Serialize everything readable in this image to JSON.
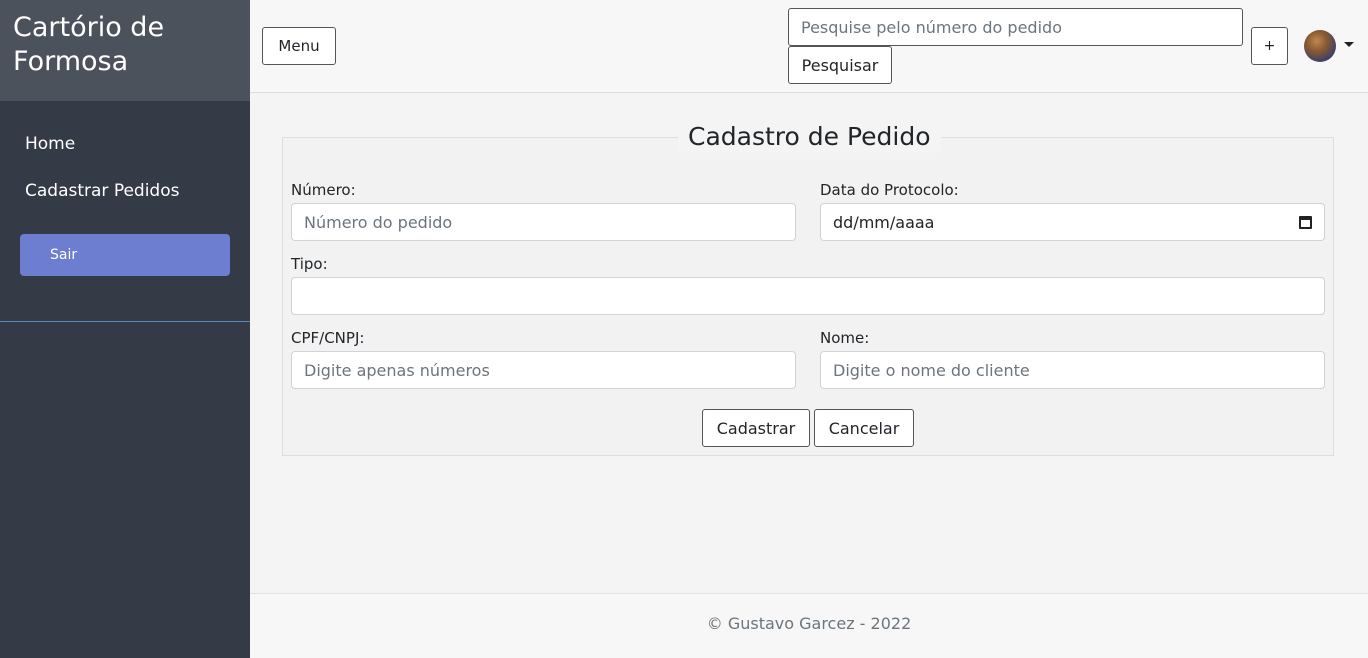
{
  "sidebar": {
    "brand": "Cartório de Formosa",
    "items": [
      {
        "label": "Home"
      },
      {
        "label": "Cadastrar Pedidos"
      }
    ],
    "logout_label": "Sair"
  },
  "topbar": {
    "menu_label": "Menu",
    "search_placeholder": "Pesquise pelo número do pedido",
    "search_button": "Pesquisar",
    "plus_label": "+",
    "avatar_icon": "user-avatar"
  },
  "form": {
    "title": "Cadastro de Pedido",
    "numero": {
      "label": "Número:",
      "placeholder": "Número do pedido"
    },
    "data_protocolo": {
      "label": "Data do Protocolo:",
      "value": "dd/mm/aaaa",
      "icon": "calendar-icon"
    },
    "tipo": {
      "label": "Tipo:",
      "value": ""
    },
    "cpf": {
      "label": "CPF/CNPJ:",
      "placeholder": "Digite apenas números"
    },
    "nome": {
      "label": "Nome:",
      "placeholder": "Digite o nome do cliente"
    },
    "submit_label": "Cadastrar",
    "cancel_label": "Cancelar"
  },
  "footer": {
    "text": "© Gustavo Garcez - 2022"
  },
  "colors": {
    "sidebar_bg": "#343a46",
    "brand_bg": "#4c525c",
    "accent": "#6d7dd0",
    "page_bg": "#f4f4f4"
  }
}
